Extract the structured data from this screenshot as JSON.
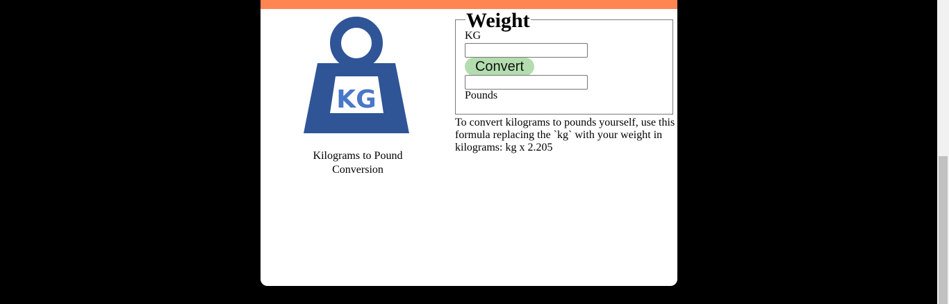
{
  "colors": {
    "topbar": "#ff8552",
    "logo_blue": "#2f5597",
    "logo_text": "#4a78c8",
    "convert_button_bg": "#b3ddae"
  },
  "logo": {
    "icon": "kg-weight-icon",
    "text": "KG"
  },
  "caption": "Kilograms to Pound Conversion",
  "converter": {
    "legend": "Weight",
    "kg_label": "KG",
    "kg_value": "",
    "convert_label": "Convert",
    "pounds_value": "",
    "pounds_label": "Pounds"
  },
  "formula_text": "To convert kilograms to pounds yourself, use this formula replacing the `kg` with your weight in kilograms: kg x 2.205"
}
